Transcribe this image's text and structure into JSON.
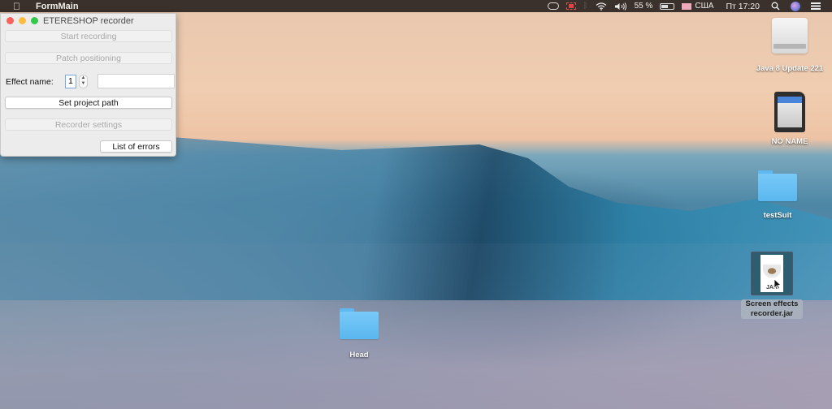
{
  "menubar": {
    "app_name": "FormMain",
    "battery_percent": "55 %",
    "input_source": "США",
    "clock": "Пт 17:20",
    "icons": [
      "apple-icon",
      "creative-cloud-icon",
      "screen-record-icon",
      "bluetooth-icon",
      "wifi-icon",
      "volume-icon",
      "battery-icon",
      "flag-icon",
      "search-icon",
      "siri-icon",
      "notification-center-icon"
    ]
  },
  "window": {
    "title": "ETERESHOP recorder",
    "buttons": {
      "start_recording": "Start recording",
      "patch_positioning": "Patch positioning",
      "set_project_path": "Set project path",
      "recorder_settings": "Recorder settings",
      "list_of_errors": "List of errors"
    },
    "effect_name_label": "Effect name:",
    "effect_number_value": "1",
    "effect_name_value": ""
  },
  "desktop_icons": [
    {
      "label": "Java 8 Update 221",
      "type": "drive"
    },
    {
      "label": "NO NAME",
      "type": "sd-card"
    },
    {
      "label": "testSuit",
      "type": "folder"
    },
    {
      "label": "Screen effects recorder.jar",
      "type": "jar",
      "jar_badge": "JAR"
    },
    {
      "label": "Head",
      "type": "folder"
    }
  ]
}
